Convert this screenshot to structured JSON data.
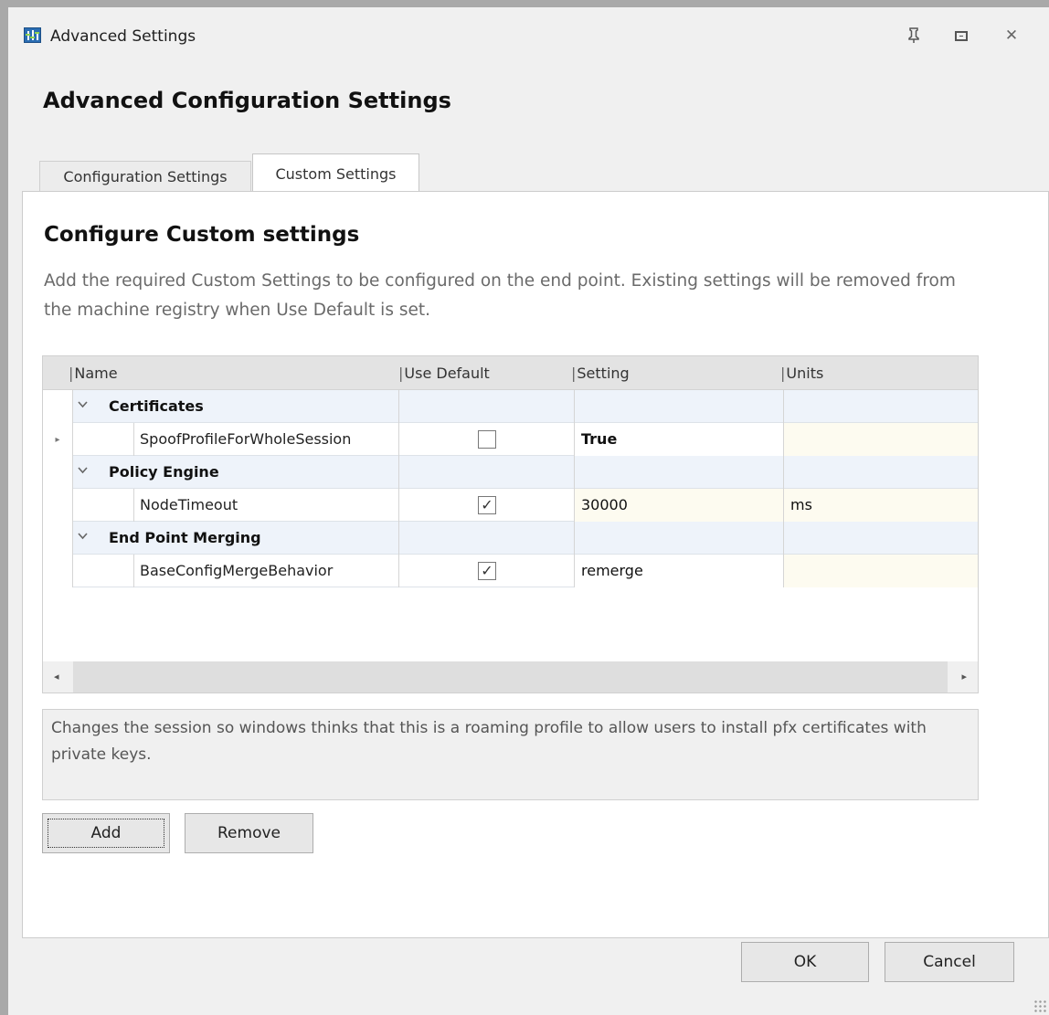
{
  "window": {
    "title": "Advanced Settings"
  },
  "heading": "Advanced Configuration Settings",
  "tabs": [
    {
      "label": "Configuration Settings",
      "active": false
    },
    {
      "label": "Custom Settings",
      "active": true
    }
  ],
  "custom": {
    "title": "Configure Custom settings",
    "description": "Add the required Custom Settings to be configured on the end point. Existing settings will be removed from the machine registry when Use Default is set."
  },
  "grid": {
    "columns": [
      "Name",
      "Use Default",
      "Setting",
      "Units"
    ],
    "groups": [
      {
        "name": "Certificates",
        "items": [
          {
            "name": "SpoofProfileForWholeSession",
            "use_default": false,
            "setting": "True",
            "units": ""
          }
        ]
      },
      {
        "name": "Policy Engine",
        "items": [
          {
            "name": "NodeTimeout",
            "use_default": true,
            "setting": "30000",
            "units": "ms"
          }
        ]
      },
      {
        "name": "End Point Merging",
        "items": [
          {
            "name": "BaseConfigMergeBehavior",
            "use_default": true,
            "setting": "remerge",
            "units": ""
          }
        ]
      }
    ]
  },
  "info_text": "Changes the session so windows thinks that this is a roaming profile to allow users to install pfx certificates with private keys.",
  "buttons": {
    "add": "Add",
    "remove": "Remove",
    "ok": "OK",
    "cancel": "Cancel"
  },
  "icons": {
    "check": "✓",
    "chevron": "⌄",
    "row_pointer": "▸",
    "scroll_left": "◂",
    "scroll_right": "▸",
    "close": "✕"
  },
  "colors": {
    "group_row": "#eef3fa",
    "editable_cell": "#fdfbf0",
    "panel": "#ffffff",
    "chrome": "#f0f0f0"
  }
}
